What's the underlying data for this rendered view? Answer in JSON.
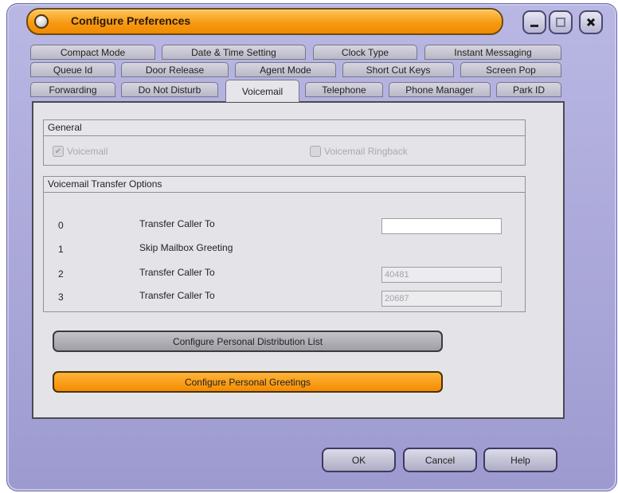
{
  "window": {
    "title": "Configure Preferences",
    "controls": [
      "minimize-icon",
      "maximize-icon",
      "close-icon"
    ]
  },
  "tabs": {
    "row1": [
      "Compact Mode",
      "Date & Time Setting",
      "Clock Type",
      "Instant Messaging"
    ],
    "row2": [
      "Queue Id",
      "Door Release",
      "Agent Mode",
      "Short Cut Keys",
      "Screen Pop"
    ],
    "row3": [
      "Forwarding",
      "Do Not Disturb",
      "Voicemail",
      "Telephone",
      "Phone Manager",
      "Park ID"
    ],
    "active": "Voicemail"
  },
  "general": {
    "header": "General",
    "voicemail_label": "Voicemail",
    "voicemail_checked": true,
    "ringback_label": "Voicemail Ringback",
    "ringback_checked": false
  },
  "transfer": {
    "header": "Voicemail Transfer Options",
    "rows": [
      {
        "num": "0",
        "label": "Transfer Caller To",
        "value": "",
        "enabled": true
      },
      {
        "num": "1",
        "label": "Skip Mailbox Greeting"
      },
      {
        "num": "2",
        "label": "Transfer Caller To",
        "value": "40481",
        "enabled": false
      },
      {
        "num": "3",
        "label": "Transfer Caller To",
        "value": "20687",
        "enabled": false
      }
    ]
  },
  "buttons": {
    "distribution_list": "Configure Personal Distribution List",
    "greetings": "Configure Personal Greetings",
    "ok": "OK",
    "cancel": "Cancel",
    "help": "Help"
  },
  "colors": {
    "accent_orange": "#f58c00",
    "frame_lavender": "#a9a6d8"
  }
}
